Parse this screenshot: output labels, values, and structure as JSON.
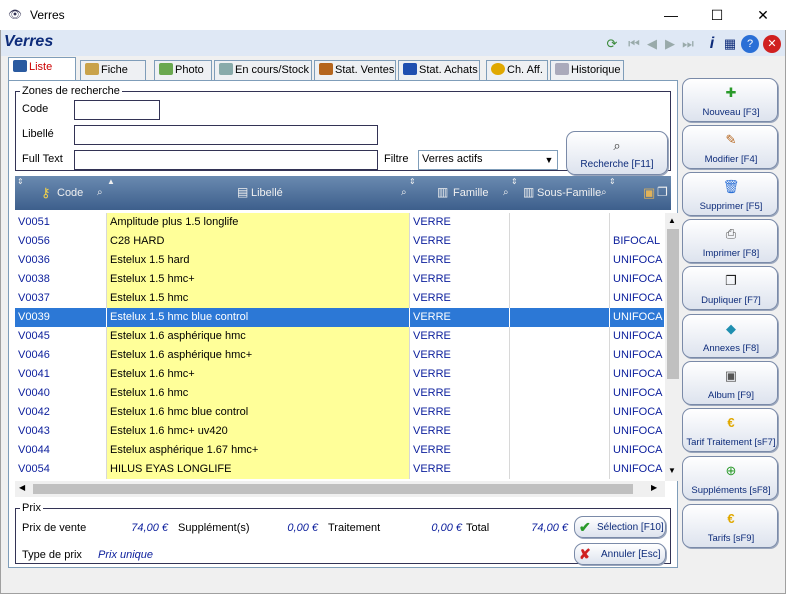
{
  "window": {
    "title": "Verres",
    "minimize_glyph": "—",
    "maximize_glyph": "☐",
    "close_glyph": "✕"
  },
  "header": {
    "title": "Verres",
    "toolbar_icons": [
      "refresh-icon",
      "first-icon",
      "prev-icon",
      "next-icon",
      "last-icon",
      "info-icon",
      "calculator-icon",
      "help-icon",
      "close-icon"
    ]
  },
  "tabs": [
    {
      "label": "Liste",
      "active": true,
      "icon": "list-icon"
    },
    {
      "label": "Fiche",
      "active": false,
      "icon": "card-icon"
    },
    {
      "label": "Photo",
      "active": false,
      "icon": "photo-icon"
    },
    {
      "label": "En cours/Stock",
      "active": false,
      "icon": "search-icon"
    },
    {
      "label": "Stat. Ventes",
      "active": false,
      "icon": "person-icon"
    },
    {
      "label": "Stat. Achats",
      "active": false,
      "icon": "truck-icon"
    },
    {
      "label": "Ch. Aff.",
      "active": false,
      "icon": "euro-icon"
    },
    {
      "label": "Historique",
      "active": false,
      "icon": "history-icon"
    }
  ],
  "search": {
    "legend": "Zones de recherche",
    "code_label": "Code",
    "code_value": "",
    "libelle_label": "Libellé",
    "libelle_value": "",
    "fulltext_label": "Full Text",
    "fulltext_value": "",
    "filtre_label": "Filtre",
    "filtre_value": "Verres actifs",
    "search_button": "Recherche [F11]"
  },
  "table": {
    "columns": [
      "Code",
      "Libellé",
      "Famille",
      "Sous-Famille"
    ],
    "selected_index": 5,
    "rows": [
      {
        "code": "V0051",
        "libelle": "Amplitude plus 1.5 longlife",
        "famille": "VERRE",
        "sous_famille": "",
        "ext": ""
      },
      {
        "code": "V0056",
        "libelle": "C28 HARD",
        "famille": "VERRE",
        "sous_famille": "",
        "ext": "BIFOCAL"
      },
      {
        "code": "V0036",
        "libelle": "Estelux 1.5 hard",
        "famille": "VERRE",
        "sous_famille": "",
        "ext": "UNIFOCA"
      },
      {
        "code": "V0038",
        "libelle": "Estelux 1.5 hmc+",
        "famille": "VERRE",
        "sous_famille": "",
        "ext": "UNIFOCA"
      },
      {
        "code": "V0037",
        "libelle": "Estelux 1.5 hmc",
        "famille": "VERRE",
        "sous_famille": "",
        "ext": "UNIFOCA"
      },
      {
        "code": "V0039",
        "libelle": "Estelux 1.5 hmc blue control",
        "famille": "VERRE",
        "sous_famille": "",
        "ext": "UNIFOCA"
      },
      {
        "code": "V0045",
        "libelle": "Estelux 1.6 asphérique hmc",
        "famille": "VERRE",
        "sous_famille": "",
        "ext": "UNIFOCA"
      },
      {
        "code": "V0046",
        "libelle": "Estelux 1.6 asphérique hmc+",
        "famille": "VERRE",
        "sous_famille": "",
        "ext": "UNIFOCA"
      },
      {
        "code": "V0041",
        "libelle": "Estelux 1.6 hmc+",
        "famille": "VERRE",
        "sous_famille": "",
        "ext": "UNIFOCA"
      },
      {
        "code": "V0040",
        "libelle": "Estelux 1.6 hmc",
        "famille": "VERRE",
        "sous_famille": "",
        "ext": "UNIFOCA"
      },
      {
        "code": "V0042",
        "libelle": "Estelux 1.6 hmc blue control",
        "famille": "VERRE",
        "sous_famille": "",
        "ext": "UNIFOCA"
      },
      {
        "code": "V0043",
        "libelle": "Estelux 1.6 hmc+ uv420",
        "famille": "VERRE",
        "sous_famille": "",
        "ext": "UNIFOCA"
      },
      {
        "code": "V0044",
        "libelle": "Estelux asphérique 1.67 hmc+",
        "famille": "VERRE",
        "sous_famille": "",
        "ext": "UNIFOCA"
      },
      {
        "code": "V0054",
        "libelle": "HILUS EYAS LONGLIFE",
        "famille": "VERRE",
        "sous_famille": "",
        "ext": "UNIFOCA"
      }
    ]
  },
  "prix": {
    "legend": "Prix",
    "prix_vente_label": "Prix de vente",
    "prix_vente_value": "74,00 €",
    "supplement_label": "Supplément(s)",
    "supplement_value": "0,00 €",
    "traitement_label": "Traitement",
    "traitement_value": "0,00 €",
    "total_label": "Total",
    "total_value": "74,00 €",
    "type_label": "Type de prix",
    "type_value": "Prix unique",
    "selection_button": "Sélection [F10]",
    "annuler_button": "Annuler [Esc]"
  },
  "actions": [
    {
      "label": "Nouveau [F3]",
      "icon": "new-icon"
    },
    {
      "label": "Modifier [F4]",
      "icon": "edit-icon"
    },
    {
      "label": "Supprimer [F5]",
      "icon": "trash-icon"
    },
    {
      "label": "Imprimer [F8]",
      "icon": "printer-icon"
    },
    {
      "label": "Dupliquer [F7]",
      "icon": "duplicate-icon"
    },
    {
      "label": "Annexes [F8]",
      "icon": "book-icon"
    },
    {
      "label": "Album [F9]",
      "icon": "album-icon"
    },
    {
      "label": "Tarif Traitement [sF7]",
      "icon": "euro-icon"
    },
    {
      "label": "Suppléments [sF8]",
      "icon": "plus-icon"
    },
    {
      "label": "Tarifs  [sF9]",
      "icon": "euro-icon"
    }
  ],
  "colors": {
    "accent": "#0d2b7a",
    "selected_row": "#2c78d6",
    "libelle_bg": "#ffff99",
    "active_tab": "#c00000"
  }
}
